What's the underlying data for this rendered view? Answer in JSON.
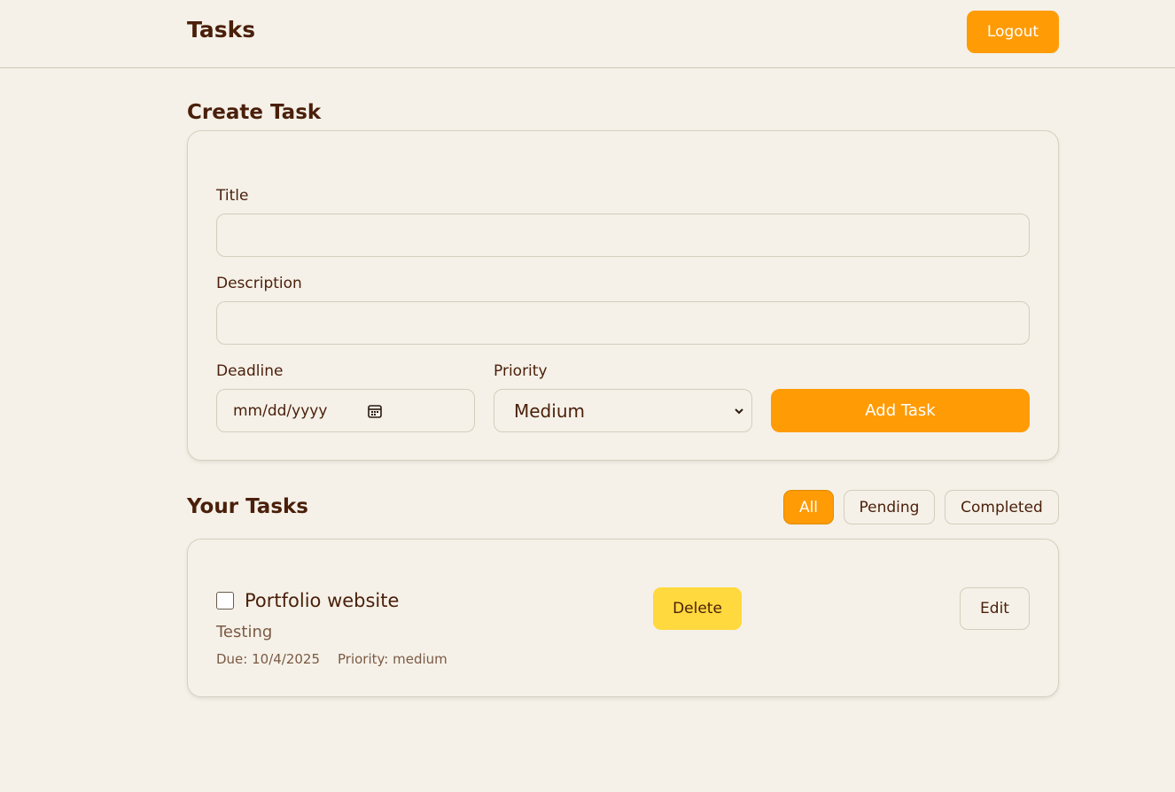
{
  "header": {
    "title": "Tasks",
    "logout_label": "Logout"
  },
  "create_task": {
    "heading": "Create Task",
    "title_label": "Title",
    "title_value": "",
    "description_label": "Description",
    "description_value": "",
    "deadline_label": "Deadline",
    "deadline_placeholder": "mm/dd/yyyy",
    "priority_label": "Priority",
    "priority_selected": "Medium",
    "add_button_label": "Add Task"
  },
  "tasks": {
    "heading": "Your Tasks",
    "filters": [
      {
        "label": "All",
        "active": true
      },
      {
        "label": "Pending",
        "active": false
      },
      {
        "label": "Completed",
        "active": false
      }
    ],
    "items": [
      {
        "title": "Portfolio website",
        "description": "Testing",
        "due": "Due: 10/4/2025",
        "priority": "Priority: medium",
        "completed": false,
        "delete_label": "Delete",
        "edit_label": "Edit"
      }
    ]
  },
  "colors": {
    "background": "#f5f1e8",
    "accent": "#ff9b05",
    "delete": "#ffd93d",
    "text": "#4a1f0a"
  }
}
